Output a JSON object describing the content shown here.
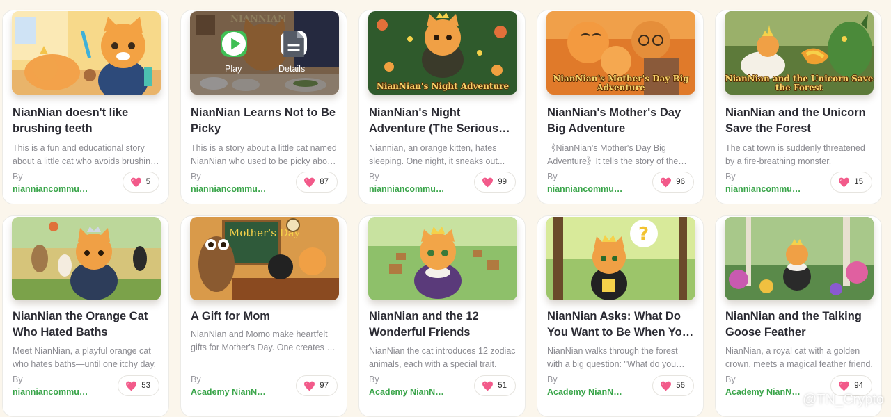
{
  "colors": {
    "background": "#fbf6ec",
    "author_green": "#3aa54a",
    "heart_pink": "#f25a8a",
    "play_green": "#3fbf54"
  },
  "hover_overlay": {
    "play_label": "Play",
    "details_label": "Details"
  },
  "by_label": "By",
  "cards": [
    {
      "title": "NianNian doesn't like brushing teeth",
      "description": "This is a fun and educational story about a little cat who avoids brushing his teeth.",
      "author": "nianniancommunity",
      "likes": "5",
      "thumbnail": "cat-brushing-teeth-illustration"
    },
    {
      "title": "NianNian Learns Not to Be Picky",
      "description": "This is a story about a little cat named NianNian who used to be picky about food.",
      "author": "nianniancommunity",
      "likes": "87",
      "thumbnail": "cat-at-dinner-table-illustration",
      "cover_text": "NIANNIAN"
    },
    {
      "title": "NianNian's Night Adventure (The Serious Version)",
      "description": "Niannian, an orange kitten, hates sleeping. One night, it sneaks out...",
      "author": "nianniancommunity",
      "likes": "99",
      "thumbnail": "cat-running-in-garden-illustration",
      "cover_text": "NianNian's Night Adventure"
    },
    {
      "title": "NianNian's Mother's Day Big Adventure",
      "description": "《NianNian's Mother's Day Big Adventure》It tells the story of the little cat.",
      "author": "nianniancommunity",
      "likes": "96",
      "thumbnail": "cat-family-hug-illustration",
      "cover_text": "NianNian's Mother's Day Big Adventure"
    },
    {
      "title": "NianNian and the Unicorn Save the Forest",
      "description": "The cat town is suddenly threatened by a fire-breathing monster.",
      "author": "nianniancommunity",
      "likes": "15",
      "thumbnail": "cat-unicorn-dragon-illustration",
      "cover_text": "NianNian and the Unicorn Save the Forest"
    },
    {
      "title": " NianNian the Orange Cat Who Hated Baths",
      "description": "Meet NianNian, a playful orange cat who hates baths—until one itchy day.",
      "author": "nianniancommunity",
      "likes": "53",
      "thumbnail": "cat-with-friends-illustration"
    },
    {
      "title": "A Gift for Mom",
      "description": "NianNian and Momo make heartfelt gifts for Mother's Day. One creates a card.",
      "author": "Academy NianNian",
      "likes": "97",
      "thumbnail": "owl-teacher-classroom-illustration",
      "cover_text": "Mother's Day"
    },
    {
      "title": "NianNian and the 12 Wonderful Friends",
      "description": "NianNian the cat introduces 12 zodiac animals, each with a special trait.",
      "author": "Academy NianNian",
      "likes": "51",
      "thumbnail": "cat-king-village-illustration"
    },
    {
      "title": "NianNian Asks: What Do You Want to Be When You Grow Up?",
      "description": "NianNian walks through the forest with a big question: \"What do you want to be?\"",
      "author": "Academy NianNian",
      "likes": "56",
      "thumbnail": "cat-question-mark-forest-illustration"
    },
    {
      "title": "NianNian and the Talking Goose Feather",
      "description": "NianNian, a royal cat with a golden crown, meets a magical feather friend.",
      "author": "Academy NianNian",
      "likes": "94",
      "thumbnail": "cat-in-flower-forest-illustration"
    }
  ],
  "watermark": {
    "text": "@TN_Crypto",
    "icon": "binance-diamond-icon"
  }
}
